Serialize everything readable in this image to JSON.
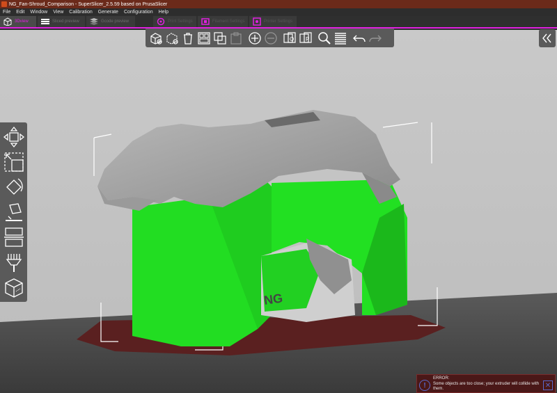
{
  "window": {
    "title": "NG_Fan-Shroud_Comparison - SuperSlicer_2.5.59  based on PrusaSlicer"
  },
  "menu": [
    "File",
    "Edit",
    "Window",
    "View",
    "Calibration",
    "Generate",
    "Configuration",
    "Help"
  ],
  "tabs": [
    {
      "label": "3Dview",
      "active": true
    },
    {
      "label": "Sliced preview",
      "active": false
    },
    {
      "label": "Gcode preview",
      "active": false
    },
    {
      "label": "Print Settings",
      "active": false
    },
    {
      "label": "Filament Settings",
      "active": false
    },
    {
      "label": "Printer Settings",
      "active": false
    }
  ],
  "error": {
    "title": "ERROR:",
    "message": "Some objects are too close; your extruder will collide with them."
  },
  "colors": {
    "accent": "#e020e0",
    "model_grey": "#a8a8a8",
    "overhang_green": "#22e022",
    "bed_shadow": "#5a2020",
    "background": "#c8c8c8"
  }
}
